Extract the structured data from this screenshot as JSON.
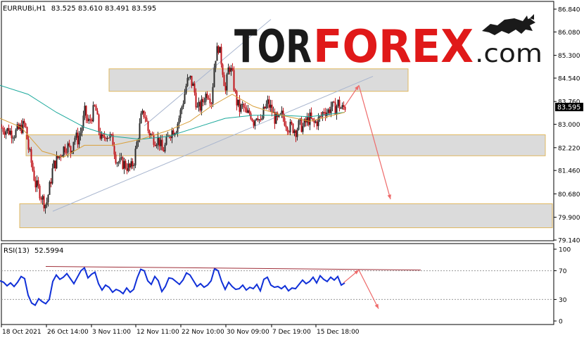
{
  "chart_data": [
    {
      "type": "candlestick",
      "symbol": "EURRUBi,H1",
      "ohlc_label": "83.525 83.610 83.491 83.595",
      "last_price_label": "83.595",
      "y_ticks": [
        "86.840",
        "86.080",
        "85.300",
        "84.540",
        "83.760",
        "83.000",
        "82.220",
        "81.460",
        "80.680",
        "79.900",
        "79.140"
      ],
      "ylim": [
        79.14,
        86.84
      ],
      "x_ticks": [
        "18 Oct 2021",
        "26 Oct 14:00",
        "3 Nov 11:00",
        "12 Nov 11:00",
        "22 Nov 10:00",
        "30 Nov 09:00",
        "7 Dec 19:00",
        "15 Dec 18:00"
      ],
      "close_path": [
        [
          0,
          82.9
        ],
        [
          20,
          82.7
        ],
        [
          30,
          82.9
        ],
        [
          35,
          83.0
        ],
        [
          40,
          82.2
        ],
        [
          45,
          81.6
        ],
        [
          50,
          81.0
        ],
        [
          55,
          80.8
        ],
        [
          60,
          80.5
        ],
        [
          65,
          80.3
        ],
        [
          70,
          80.9
        ],
        [
          75,
          81.6
        ],
        [
          80,
          81.8
        ],
        [
          85,
          82.0
        ],
        [
          90,
          82.2
        ],
        [
          95,
          82.3
        ],
        [
          100,
          82.1
        ],
        [
          105,
          82.6
        ],
        [
          110,
          82.5
        ],
        [
          115,
          82.8
        ],
        [
          120,
          83.4
        ],
        [
          125,
          83.0
        ],
        [
          130,
          83.3
        ],
        [
          135,
          83.6
        ],
        [
          140,
          82.8
        ],
        [
          145,
          82.4
        ],
        [
          150,
          82.7
        ],
        [
          155,
          82.6
        ],
        [
          160,
          82.4
        ],
        [
          165,
          81.8
        ],
        [
          170,
          81.7
        ],
        [
          175,
          81.7
        ],
        [
          180,
          81.6
        ],
        [
          185,
          81.5
        ],
        [
          190,
          81.8
        ],
        [
          195,
          82.5
        ],
        [
          200,
          83.2
        ],
        [
          205,
          83.4
        ],
        [
          210,
          82.8
        ],
        [
          215,
          82.6
        ],
        [
          220,
          82.5
        ],
        [
          225,
          82.5
        ],
        [
          230,
          82.1
        ],
        [
          235,
          82.3
        ],
        [
          240,
          82.7
        ],
        [
          245,
          82.8
        ],
        [
          250,
          82.9
        ],
        [
          255,
          83.3
        ],
        [
          260,
          83.8
        ],
        [
          265,
          84.4
        ],
        [
          270,
          84.5
        ],
        [
          275,
          84.2
        ],
        [
          280,
          83.5
        ],
        [
          285,
          83.6
        ],
        [
          290,
          83.9
        ],
        [
          295,
          84.1
        ],
        [
          300,
          83.8
        ],
        [
          305,
          85.2
        ],
        [
          310,
          85.6
        ],
        [
          315,
          85.0
        ],
        [
          320,
          84.1
        ],
        [
          325,
          85.0
        ],
        [
          330,
          84.6
        ],
        [
          335,
          83.8
        ],
        [
          340,
          83.5
        ],
        [
          345,
          83.6
        ],
        [
          350,
          83.3
        ],
        [
          355,
          83.4
        ],
        [
          360,
          83.1
        ],
        [
          365,
          83.4
        ],
        [
          370,
          83.0
        ],
        [
          375,
          83.5
        ],
        [
          380,
          83.7
        ],
        [
          385,
          83.5
        ],
        [
          390,
          83.2
        ],
        [
          395,
          83.1
        ],
        [
          400,
          83.3
        ],
        [
          405,
          83.1
        ],
        [
          410,
          82.9
        ],
        [
          415,
          82.9
        ],
        [
          420,
          82.8
        ],
        [
          425,
          83.0
        ],
        [
          430,
          82.9
        ],
        [
          435,
          83.1
        ],
        [
          440,
          83.2
        ],
        [
          445,
          83.0
        ],
        [
          450,
          83.1
        ],
        [
          455,
          83.2
        ],
        [
          460,
          83.5
        ],
        [
          465,
          83.4
        ],
        [
          470,
          83.6
        ],
        [
          475,
          83.5
        ],
        [
          480,
          83.7
        ],
        [
          485,
          83.5
        ],
        [
          490,
          83.6
        ]
      ],
      "ma_slow": [
        [
          0,
          84.3
        ],
        [
          40,
          84.0
        ],
        [
          80,
          83.4
        ],
        [
          120,
          82.9
        ],
        [
          160,
          82.6
        ],
        [
          200,
          82.5
        ],
        [
          240,
          82.6
        ],
        [
          280,
          82.9
        ],
        [
          320,
          83.2
        ],
        [
          360,
          83.3
        ],
        [
          400,
          83.3
        ],
        [
          440,
          83.25
        ],
        [
          490,
          83.4
        ]
      ],
      "ma_fast": [
        [
          0,
          83.2
        ],
        [
          30,
          82.9
        ],
        [
          60,
          82.1
        ],
        [
          90,
          81.9
        ],
        [
          120,
          82.3
        ],
        [
          160,
          82.3
        ],
        [
          200,
          82.5
        ],
        [
          240,
          82.8
        ],
        [
          270,
          83.1
        ],
        [
          300,
          83.6
        ],
        [
          330,
          84.0
        ],
        [
          360,
          83.6
        ],
        [
          400,
          83.3
        ],
        [
          440,
          83.1
        ],
        [
          490,
          83.4
        ]
      ],
      "channel": {
        "upper": [
          [
            205,
            82.95
          ],
          [
            385,
            86.5
          ]
        ],
        "lower": [
          [
            75,
            80.1
          ],
          [
            530,
            84.6
          ]
        ]
      },
      "zones": [
        {
          "x0": 155,
          "x1": 580,
          "y_top": 84.85,
          "y_bottom": 84.1
        },
        {
          "x0": 37,
          "x1": 775,
          "y_top": 82.65,
          "y_bottom": 81.95
        },
        {
          "x0": 28,
          "x1": 785,
          "y_top": 80.35,
          "y_bottom": 79.55
        }
      ],
      "forecast": [
        [
          487,
          83.5
        ],
        [
          510,
          84.3
        ],
        [
          555,
          80.5
        ]
      ]
    },
    {
      "type": "line",
      "indicator": "RSI(13)",
      "value_label": "52.5994",
      "y_ticks": [
        "100",
        "70",
        "30",
        "0"
      ],
      "ylim": [
        0,
        100
      ],
      "levels": [
        70,
        30
      ],
      "values": [
        [
          0,
          56
        ],
        [
          5,
          54
        ],
        [
          10,
          49
        ],
        [
          15,
          53
        ],
        [
          20,
          48
        ],
        [
          25,
          54
        ],
        [
          30,
          62
        ],
        [
          35,
          59
        ],
        [
          40,
          36
        ],
        [
          45,
          25
        ],
        [
          50,
          22
        ],
        [
          55,
          31
        ],
        [
          60,
          27
        ],
        [
          65,
          24
        ],
        [
          70,
          30
        ],
        [
          75,
          55
        ],
        [
          80,
          64
        ],
        [
          85,
          58
        ],
        [
          90,
          61
        ],
        [
          95,
          66
        ],
        [
          100,
          59
        ],
        [
          105,
          52
        ],
        [
          110,
          61
        ],
        [
          115,
          70
        ],
        [
          120,
          74
        ],
        [
          125,
          60
        ],
        [
          130,
          65
        ],
        [
          135,
          68
        ],
        [
          140,
          52
        ],
        [
          145,
          43
        ],
        [
          150,
          50
        ],
        [
          155,
          47
        ],
        [
          160,
          40
        ],
        [
          165,
          44
        ],
        [
          170,
          42
        ],
        [
          175,
          38
        ],
        [
          180,
          46
        ],
        [
          185,
          40
        ],
        [
          190,
          44
        ],
        [
          195,
          60
        ],
        [
          200,
          72
        ],
        [
          205,
          70
        ],
        [
          210,
          56
        ],
        [
          215,
          51
        ],
        [
          220,
          62
        ],
        [
          225,
          56
        ],
        [
          230,
          41
        ],
        [
          235,
          48
        ],
        [
          240,
          60
        ],
        [
          245,
          59
        ],
        [
          250,
          55
        ],
        [
          255,
          51
        ],
        [
          260,
          57
        ],
        [
          265,
          67
        ],
        [
          270,
          64
        ],
        [
          275,
          56
        ],
        [
          280,
          48
        ],
        [
          285,
          52
        ],
        [
          290,
          47
        ],
        [
          295,
          50
        ],
        [
          300,
          56
        ],
        [
          305,
          73
        ],
        [
          310,
          70
        ],
        [
          315,
          55
        ],
        [
          320,
          44
        ],
        [
          325,
          54
        ],
        [
          330,
          48
        ],
        [
          335,
          44
        ],
        [
          340,
          45
        ],
        [
          345,
          50
        ],
        [
          350,
          43
        ],
        [
          355,
          47
        ],
        [
          360,
          45
        ],
        [
          365,
          51
        ],
        [
          370,
          42
        ],
        [
          375,
          58
        ],
        [
          380,
          61
        ],
        [
          385,
          50
        ],
        [
          390,
          47
        ],
        [
          395,
          48
        ],
        [
          400,
          45
        ],
        [
          405,
          49
        ],
        [
          410,
          42
        ],
        [
          415,
          46
        ],
        [
          420,
          45
        ],
        [
          425,
          51
        ],
        [
          430,
          57
        ],
        [
          435,
          52
        ],
        [
          440,
          55
        ],
        [
          445,
          61
        ],
        [
          450,
          53
        ],
        [
          455,
          63
        ],
        [
          460,
          58
        ],
        [
          465,
          55
        ],
        [
          470,
          61
        ],
        [
          475,
          57
        ],
        [
          480,
          62
        ],
        [
          485,
          50
        ],
        [
          490,
          53
        ]
      ],
      "trendline": [
        [
          65,
          76
        ],
        [
          598,
          71
        ]
      ],
      "forecast": [
        [
          488,
          53
        ],
        [
          510,
          71
        ],
        [
          538,
          17
        ]
      ]
    }
  ],
  "watermark": {
    "part1": "TOR",
    "part2": "FOREX",
    "part3": ".com"
  },
  "colors": {
    "bull": "#2b2b2b",
    "bear": "#c0141b",
    "ma_slow": "#1aa89b",
    "ma_fast": "#d9a03a",
    "channel": "#a9b6cf",
    "zone_fill": "#d9d9d9",
    "zone_border": "#e0b860",
    "arrow": "#ee6a6a",
    "rsi": "#1030d8",
    "rsi_trend": "#a0303a",
    "axis": "#000000",
    "price_tag": "#000000",
    "logo_red": "#e01919",
    "logo_dark": "#1a1a1a"
  }
}
